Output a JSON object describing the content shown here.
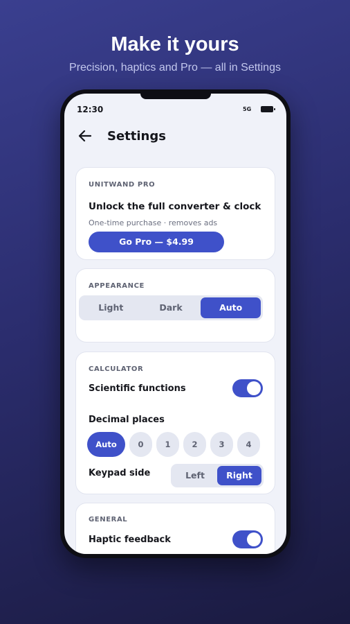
{
  "promo": {
    "headline": "Make it yours",
    "subline": "Precision, haptics and Pro — all in Settings"
  },
  "status_bar": {
    "time": "12:30",
    "network": "5G"
  },
  "header": {
    "title": "Settings",
    "back_icon": "arrow-left-icon"
  },
  "pro_card": {
    "label": "UNITWAND PRO",
    "heading": "Unlock the full converter & clock",
    "caption": "One-time purchase · removes ads",
    "button_label": "Go Pro — $4.99"
  },
  "appearance": {
    "label": "APPEARANCE",
    "options": [
      "Light",
      "Dark",
      "Auto"
    ],
    "selected": "Auto"
  },
  "calculator": {
    "label": "CALCULATOR",
    "scientific_label": "Scientific functions",
    "scientific_on": true,
    "decimal_label": "Decimal places",
    "decimal_options": [
      "Auto",
      "0",
      "1",
      "2",
      "3",
      "4"
    ],
    "decimal_selected": "Auto",
    "keypad_label": "Keypad side",
    "keypad_options": [
      "Left",
      "Right"
    ],
    "keypad_selected": "Right"
  },
  "general": {
    "label": "GENERAL",
    "haptic_label": "Haptic feedback",
    "haptic_on": true
  },
  "colors": {
    "accent": "#3f51c9",
    "background_top": "#3a3f8f",
    "background_bottom": "#1a1a3f",
    "screen": "#f0f2f9"
  }
}
